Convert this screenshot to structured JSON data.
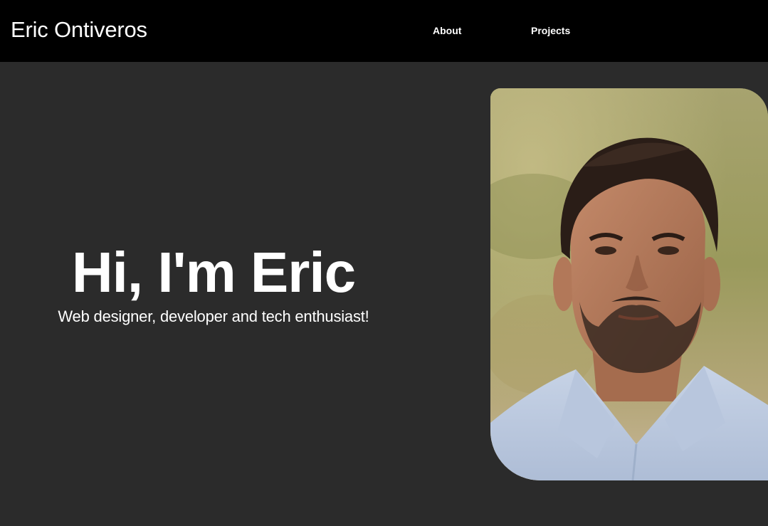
{
  "header": {
    "brand": "Eric Ontiveros",
    "nav": [
      {
        "label": "About"
      },
      {
        "label": "Projects"
      }
    ]
  },
  "hero": {
    "title": "Hi, I'm Eric",
    "subtitle": "Web designer, developer and tech enthusiast!"
  },
  "portrait": {
    "alt": "portrait photo"
  },
  "colors": {
    "nav_bg": "#000000",
    "page_bg": "#2b2b2b",
    "text": "#ffffff"
  }
}
